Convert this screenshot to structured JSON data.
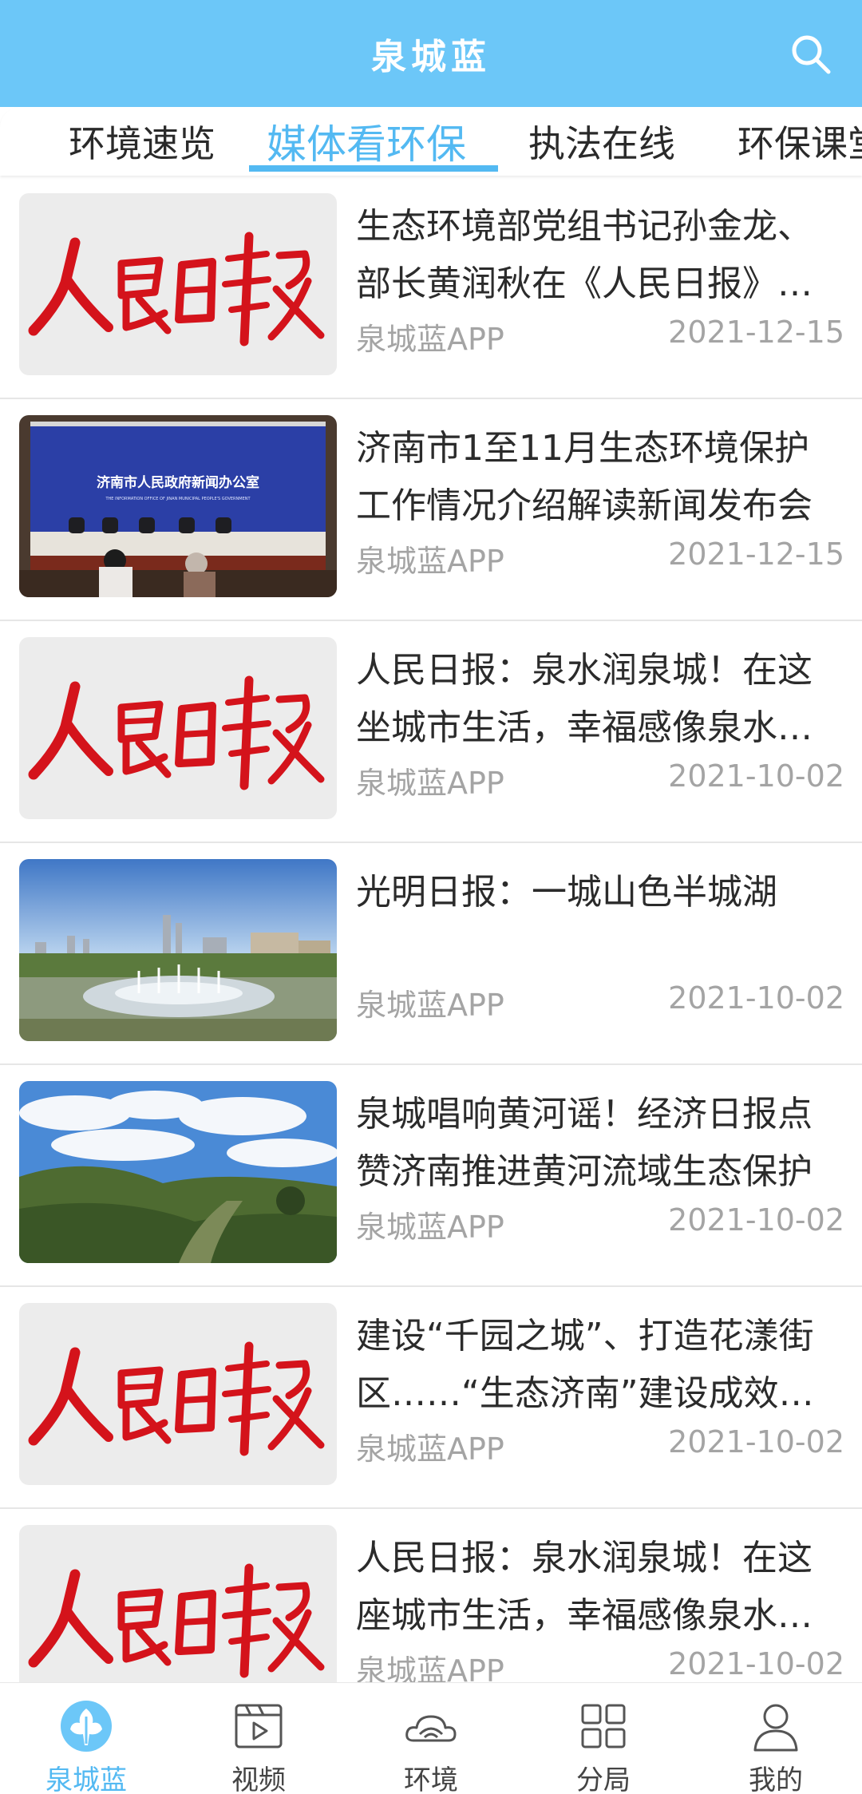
{
  "header": {
    "title": "泉城蓝"
  },
  "tabs": [
    {
      "label": "环境速览"
    },
    {
      "label": "媒体看环保"
    },
    {
      "label": "执法在线"
    },
    {
      "label": "环保课堂"
    }
  ],
  "thumb_text": {
    "press_office": "济南市人民政府新闻办公室",
    "press_office_en": "THE INFORMATION OFFICE OF JINAN MUNICIPAL PEOPLE'S GOVERNMENT"
  },
  "articles": [
    {
      "title": "生态环境部党组书记孙金龙、部长黄润秋在《人民日报》发表署名文章",
      "source": "泉城蓝APP",
      "date": "2021-12-15",
      "thumb": "renmin-ribao-logo"
    },
    {
      "title": "济南市1至11月生态环境保护工作情况介绍解读新闻发布会",
      "source": "泉城蓝APP",
      "date": "2021-12-15",
      "thumb": "press-conference-photo"
    },
    {
      "title": "人民日报：泉水润泉城！在这坐城市生活，幸福感像泉水一样",
      "source": "泉城蓝APP",
      "date": "2021-10-02",
      "thumb": "renmin-ribao-logo"
    },
    {
      "title": "光明日报：一城山色半城湖",
      "source": "泉城蓝APP",
      "date": "2021-10-02",
      "thumb": "city-fountain-photo"
    },
    {
      "title": "泉城唱响黄河谣！经济日报点赞济南推进黄河流域生态保护",
      "source": "泉城蓝APP",
      "date": "2021-10-02",
      "thumb": "mountain-landscape-photo"
    },
    {
      "title": "建设“千园之城”、打造花漾街区……“生态济南”建设成效显著",
      "source": "泉城蓝APP",
      "date": "2021-10-02",
      "thumb": "renmin-ribao-logo"
    },
    {
      "title": "人民日报：泉水润泉城！在这座城市生活，幸福感像泉水一样",
      "source": "泉城蓝APP",
      "date": "2021-10-02",
      "thumb": "renmin-ribao-logo"
    }
  ],
  "bottom_nav": [
    {
      "label": "泉城蓝",
      "icon": "quancheng-logo-icon"
    },
    {
      "label": "视频",
      "icon": "video-icon"
    },
    {
      "label": "环境",
      "icon": "environment-icon"
    },
    {
      "label": "分局",
      "icon": "grid-icon"
    },
    {
      "label": "我的",
      "icon": "profile-icon"
    }
  ],
  "colors": {
    "header": "#6cc7f8",
    "accent": "#53b9f2",
    "logo_red": "#d4131b"
  }
}
